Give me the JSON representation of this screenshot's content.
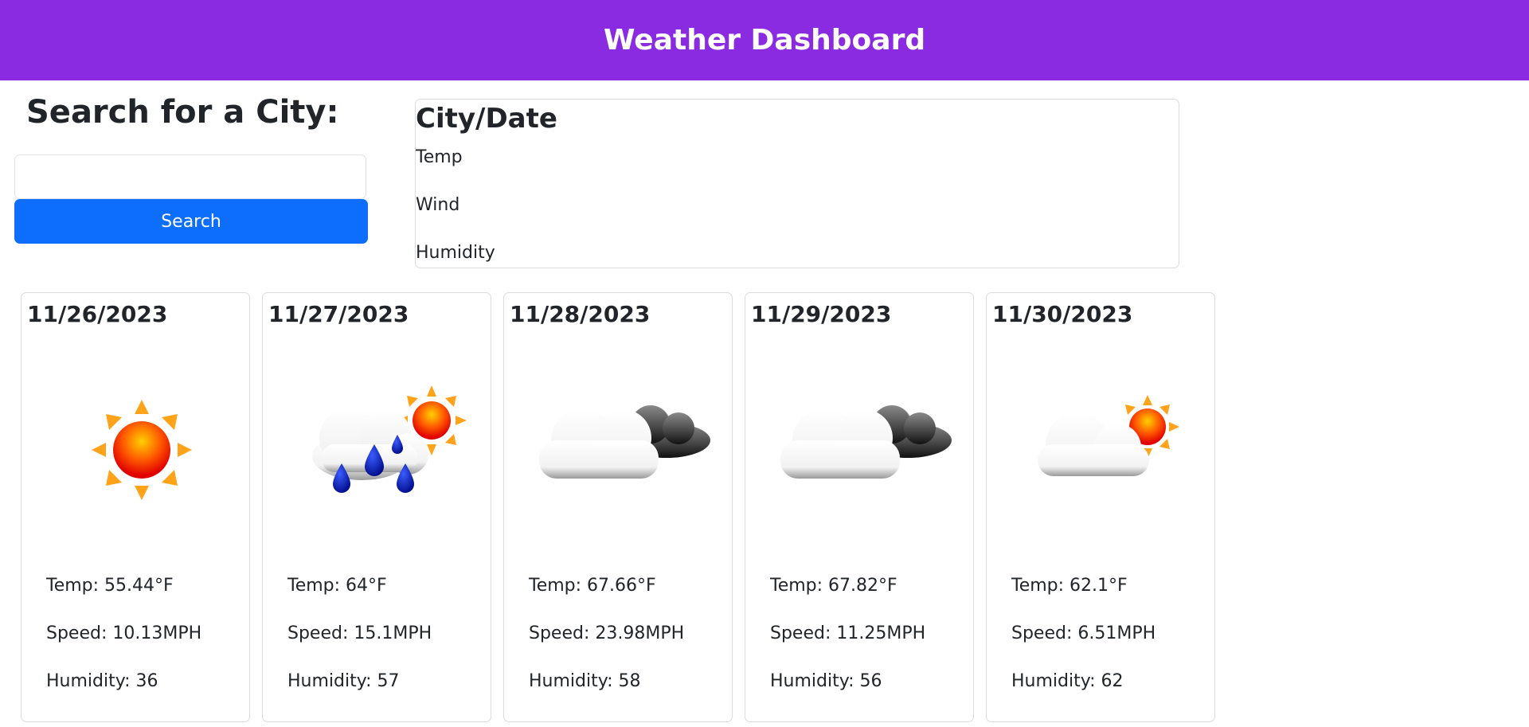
{
  "colors": {
    "header_bg": "#8a2be2",
    "button_bg": "#0d6efd"
  },
  "header": {
    "title": "Weather Dashboard"
  },
  "search": {
    "title": "Search for a City:",
    "input_value": "",
    "button_label": "Search"
  },
  "current": {
    "heading": "City/Date",
    "temp_label": "Temp",
    "wind_label": "Wind",
    "humidity_label": "Humidity"
  },
  "forecast": [
    {
      "date": "11/26/2023",
      "icon": "sunny-icon",
      "temp": "Temp: 55.44°F",
      "speed": "Speed: 10.13MPH",
      "humidity": "Humidity: 36"
    },
    {
      "date": "11/27/2023",
      "icon": "rain-sun-icon",
      "temp": "Temp: 64°F",
      "speed": "Speed: 15.1MPH",
      "humidity": "Humidity: 57"
    },
    {
      "date": "11/28/2023",
      "icon": "broken-clouds-icon",
      "temp": "Temp: 67.66°F",
      "speed": "Speed: 23.98MPH",
      "humidity": "Humidity: 58"
    },
    {
      "date": "11/29/2023",
      "icon": "broken-clouds-icon",
      "temp": "Temp: 67.82°F",
      "speed": "Speed: 11.25MPH",
      "humidity": "Humidity: 56"
    },
    {
      "date": "11/30/2023",
      "icon": "partly-cloudy-icon",
      "temp": "Temp: 62.1°F",
      "speed": "Speed: 6.51MPH",
      "humidity": "Humidity: 62"
    }
  ]
}
